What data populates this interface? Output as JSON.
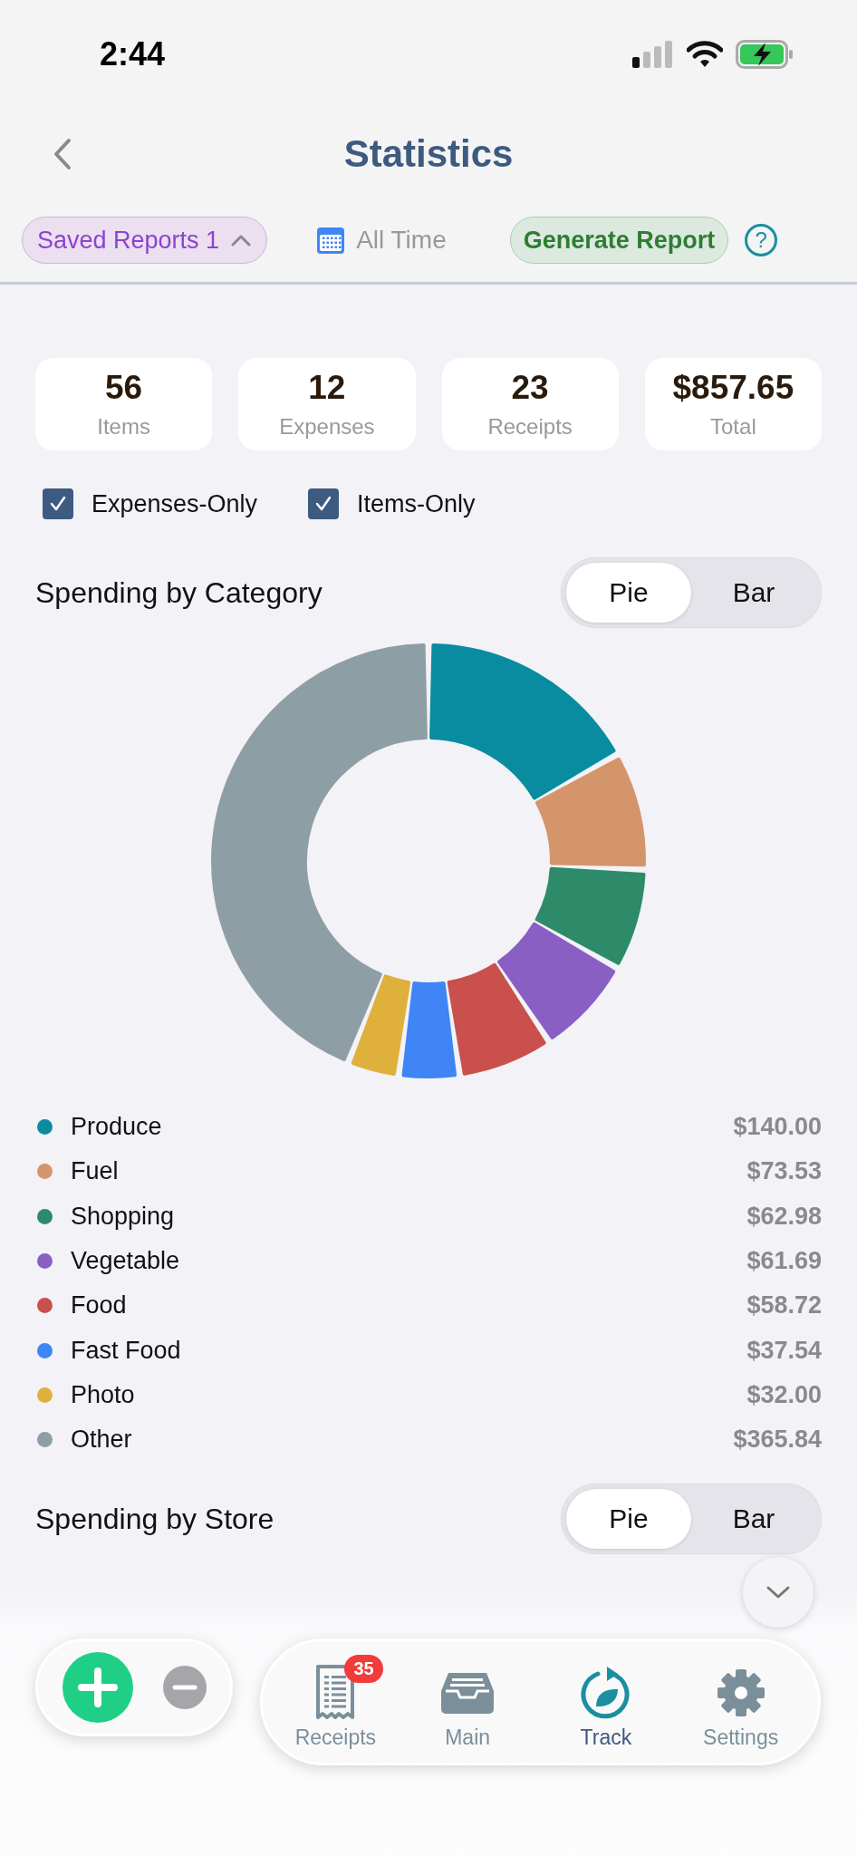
{
  "status_bar": {
    "time": "2:44"
  },
  "header": {
    "title": "Statistics"
  },
  "toolbar": {
    "saved_reports": {
      "label": "Saved Reports 1",
      "expanded": true
    },
    "date_range": "All Time",
    "generate": "Generate Report",
    "help": "?"
  },
  "stats": [
    {
      "value": "56",
      "label": "Items"
    },
    {
      "value": "12",
      "label": "Expenses"
    },
    {
      "value": "23",
      "label": "Receipts"
    },
    {
      "value": "$857.65",
      "label": "Total"
    }
  ],
  "filters": [
    {
      "label": "Expenses-Only",
      "checked": true
    },
    {
      "label": "Items-Only",
      "checked": true
    }
  ],
  "category_section": {
    "title": "Spending by Category",
    "view_toggle": [
      {
        "label": "Pie",
        "selected": true
      },
      {
        "label": "Bar",
        "selected": false
      }
    ],
    "chart_data": {
      "type": "donut",
      "categories": [
        "Produce",
        "Fuel",
        "Shopping",
        "Vegetable",
        "Food",
        "Fast Food",
        "Photo",
        "Other"
      ],
      "values": [
        16.82,
        8.83,
        7.57,
        7.41,
        7.06,
        4.51,
        3.84,
        43.96
      ]
    },
    "legend": [
      {
        "amount": "$140.00",
        "color": "#0a8ca0"
      },
      {
        "amount": "$73.53",
        "color": "#d4956b"
      },
      {
        "amount": "$62.98",
        "color": "#2e8b6a"
      },
      {
        "amount": "$61.69",
        "color": "#8a5fc4"
      },
      {
        "amount": "$58.72",
        "color": "#c9504c"
      },
      {
        "amount": "$37.54",
        "color": "#3f85f5"
      },
      {
        "amount": "$32.00",
        "color": "#e0b03c"
      },
      {
        "amount": "$365.84",
        "color": "#8e9ea5"
      }
    ]
  },
  "store_section": {
    "title": "Spending by Store",
    "view_toggle": [
      {
        "label": "Pie",
        "selected": true
      },
      {
        "label": "Bar",
        "selected": false
      }
    ]
  },
  "tab_bar": [
    {
      "kind": "receipts",
      "label": "Receipts",
      "badge": "35",
      "selected": false
    },
    {
      "kind": "main",
      "label": "Main",
      "selected": false
    },
    {
      "kind": "track",
      "label": "Track",
      "selected": true
    },
    {
      "kind": "settings",
      "label": "Settings",
      "selected": false
    }
  ]
}
